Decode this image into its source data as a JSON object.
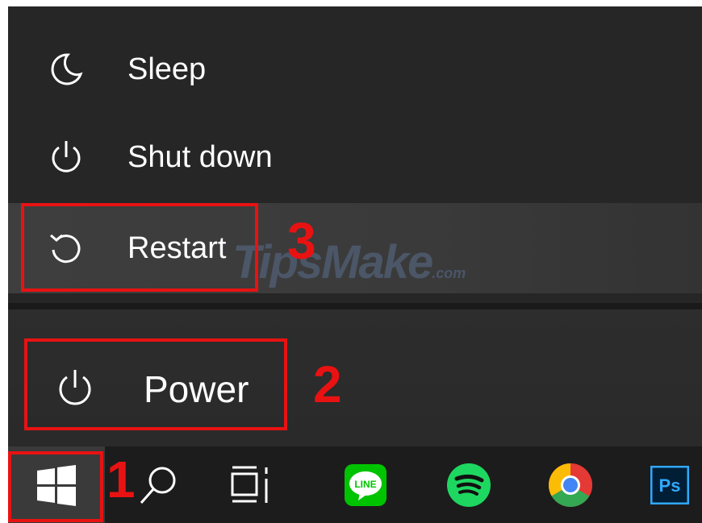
{
  "power_menu": {
    "items": [
      {
        "label": "Sleep",
        "icon": "moon-icon"
      },
      {
        "label": "Shut down",
        "icon": "power-icon"
      },
      {
        "label": "Restart",
        "icon": "restart-icon"
      }
    ]
  },
  "start_rail": {
    "power_label": "Power",
    "power_icon": "power-icon"
  },
  "taskbar": {
    "items": [
      {
        "name": "start",
        "icon": "windows-icon"
      },
      {
        "name": "search",
        "icon": "search-icon"
      },
      {
        "name": "task-view",
        "icon": "task-view-icon"
      },
      {
        "name": "line",
        "icon": "line-app-icon",
        "label": "LINE"
      },
      {
        "name": "spotify",
        "icon": "spotify-icon"
      },
      {
        "name": "chrome",
        "icon": "chrome-icon"
      },
      {
        "name": "photoshop",
        "icon": "photoshop-icon",
        "label": "Ps"
      }
    ]
  },
  "annotations": {
    "step1": "1",
    "step2": "2",
    "step3": "3",
    "color": "#e81212"
  },
  "watermark": {
    "text": "TipsMake",
    "suffix": ".com"
  },
  "colors": {
    "menu_bg": "#262626",
    "highlight_bg": "#3e3e3e",
    "taskbar_bg": "#1c1c1c",
    "line_green": "#00c300",
    "spotify_green": "#1ed760",
    "ps_blue": "#31a8ff"
  }
}
